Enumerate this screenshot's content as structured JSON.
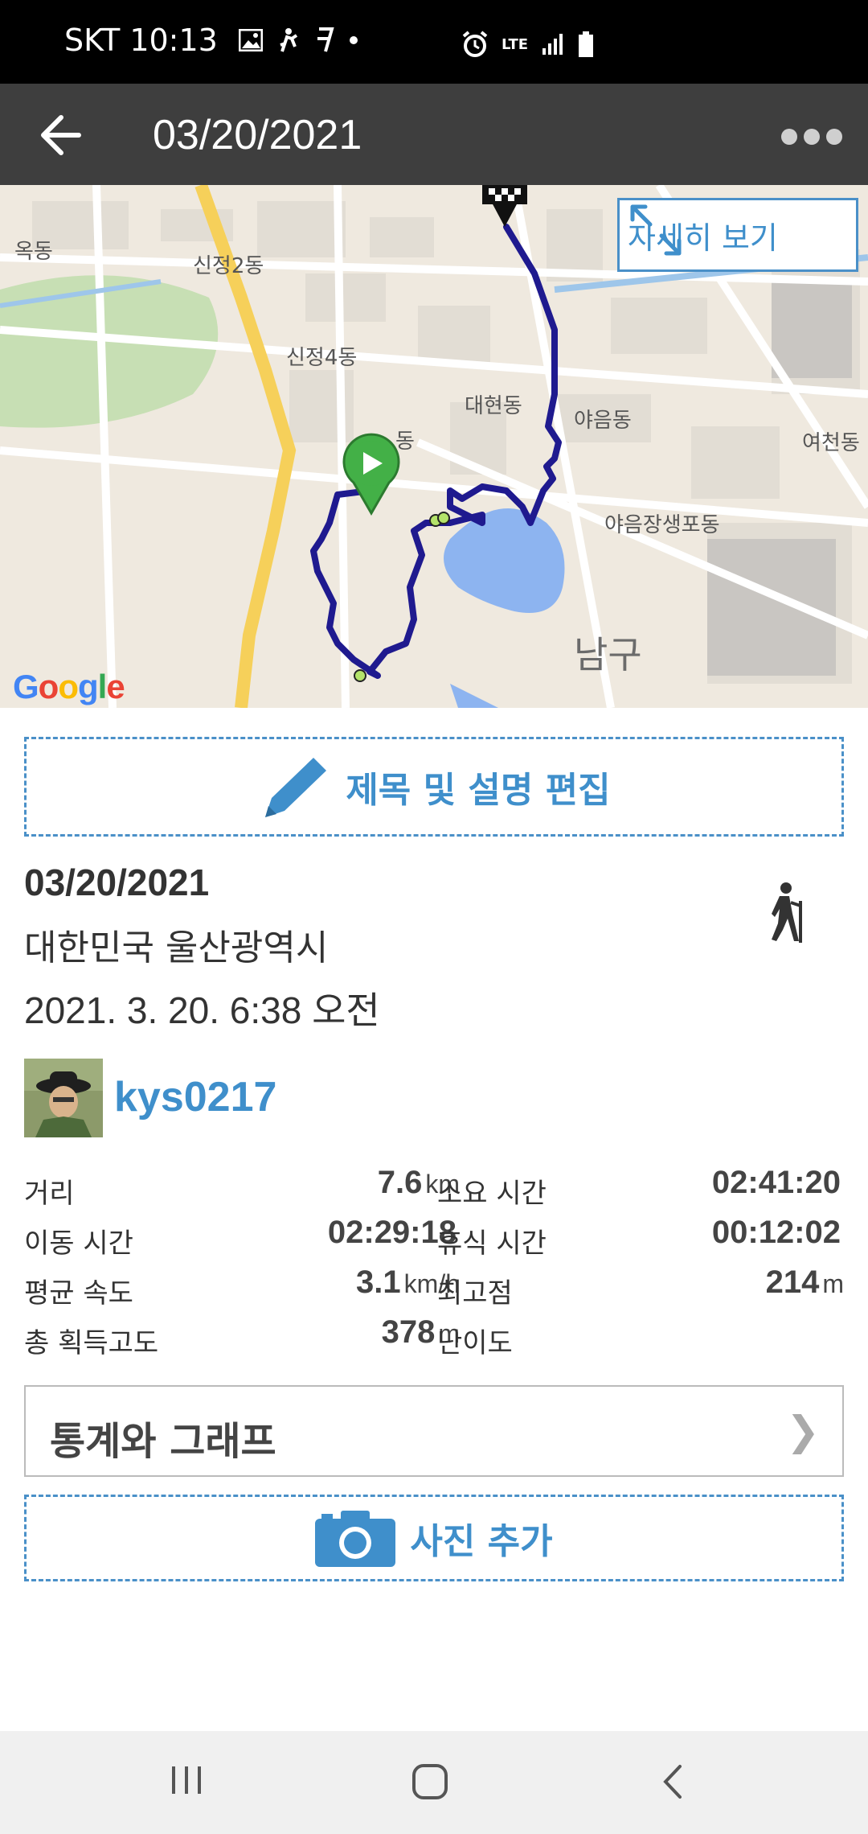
{
  "status_bar": {
    "carrier": "SKT",
    "time": "10:13",
    "network": "LTE"
  },
  "app_bar": {
    "title": "03/20/2021"
  },
  "map": {
    "detail_button_label": "자세히 보기",
    "labels": [
      "옥동",
      "신정2동",
      "신정4동",
      "대현동",
      "동",
      "야음동",
      "여천동",
      "야음장생포동",
      "남구"
    ],
    "google_logo": "Google",
    "route_color": "#1f1a8f",
    "start_marker_color": "#43b047"
  },
  "edit_button": {
    "label": "제목 및 설명 편집"
  },
  "activity": {
    "date": "03/20/2021",
    "location": "대한민국 울산광역시",
    "datetime": "2021. 3. 20. 6:38 오전",
    "activity_icon": "hiking-icon"
  },
  "user": {
    "username": "kys0217"
  },
  "stats": {
    "rows": [
      {
        "label1": "거리",
        "value1": "7.6",
        "unit1": "km",
        "label2": "소요 시간",
        "value2": "02:41:20",
        "unit2": ""
      },
      {
        "label1": "이동 시간",
        "value1": "02:29:18",
        "unit1": "",
        "label2": "휴식 시간",
        "value2": "00:12:02",
        "unit2": ""
      },
      {
        "label1": "평균 속도",
        "value1": "3.1",
        "unit1": "km/h",
        "label2": "최고점",
        "value2": "214",
        "unit2": "m"
      },
      {
        "label1": "총 획득고도",
        "value1": "378",
        "unit1": "m",
        "label2": "난이도",
        "value2": "",
        "unit2": ""
      }
    ]
  },
  "stats_link": {
    "label": "통계와 그래프",
    "chevron": "❯"
  },
  "photo_button": {
    "label": "사진 추가"
  },
  "colors": {
    "accent": "#3f8fcb",
    "appbar": "#3e3e3e"
  }
}
